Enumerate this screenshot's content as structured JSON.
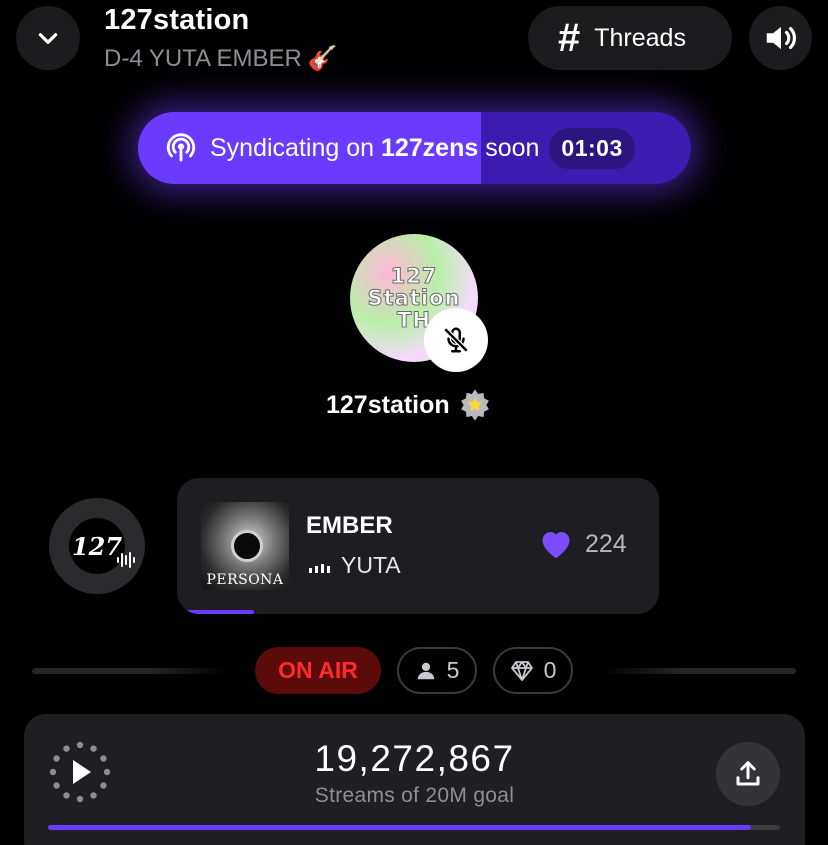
{
  "header": {
    "title": "127station",
    "subtitle": "D-4 YUTA EMBER",
    "subtitle_emoji": "🎸",
    "threads_label": "Threads"
  },
  "syndication": {
    "prefix": "Syndicating on ",
    "channel": "127zens",
    "suffix": " soon",
    "countdown": "01:03",
    "progress_percent": 62
  },
  "host": {
    "avatar_lines": [
      "127",
      "Station",
      "TH"
    ],
    "name": "127station",
    "muted": true
  },
  "station": {
    "logo_mark": "127"
  },
  "now_playing": {
    "album_text": "PERSONA",
    "title": "EMBER",
    "artist": "YUTA",
    "likes": "224",
    "progress_percent": 14
  },
  "status": {
    "on_air": "ON AIR",
    "listeners": "5",
    "gems": "0"
  },
  "player": {
    "streams": "19,272,867",
    "streams_label": "Streams of 20M goal",
    "goal_progress_percent": 96
  },
  "colors": {
    "accent": "#6a3bff",
    "on_air_red": "#ff2b2b",
    "card_bg": "#1e1e22"
  },
  "icons": {
    "collapse": "chevron-down-icon",
    "sound": "speaker-icon",
    "threads": "hash-icon",
    "broadcast": "podcast-icon",
    "mute": "mic-off-icon",
    "verified": "star-badge-icon",
    "like": "heart-icon",
    "listeners": "person-icon",
    "gems": "diamond-icon",
    "play": "play-icon",
    "share": "share-icon"
  }
}
